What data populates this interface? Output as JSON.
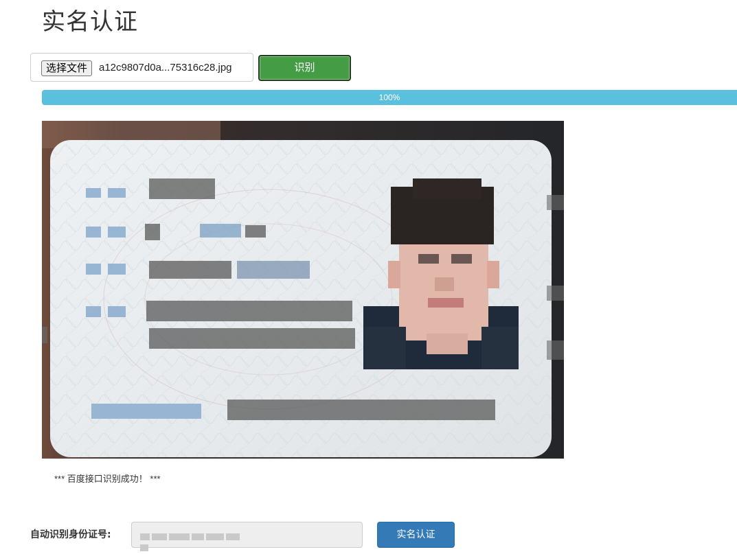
{
  "page": {
    "title": "实名认证"
  },
  "upload": {
    "choose_label": "选择文件",
    "file_name": "a12c9807d0a...75316c28.jpg",
    "recognize_label": "识别"
  },
  "progress": {
    "value": 1.0,
    "label": "100%"
  },
  "status": {
    "message": "*** 百度接口识别成功！ ***"
  },
  "form": {
    "id_label": "自动识别身份证号:",
    "verify_label": "实名认证"
  },
  "colors": {
    "success": "#449d44",
    "progress": "#5bc0de",
    "primary": "#337ab7"
  }
}
